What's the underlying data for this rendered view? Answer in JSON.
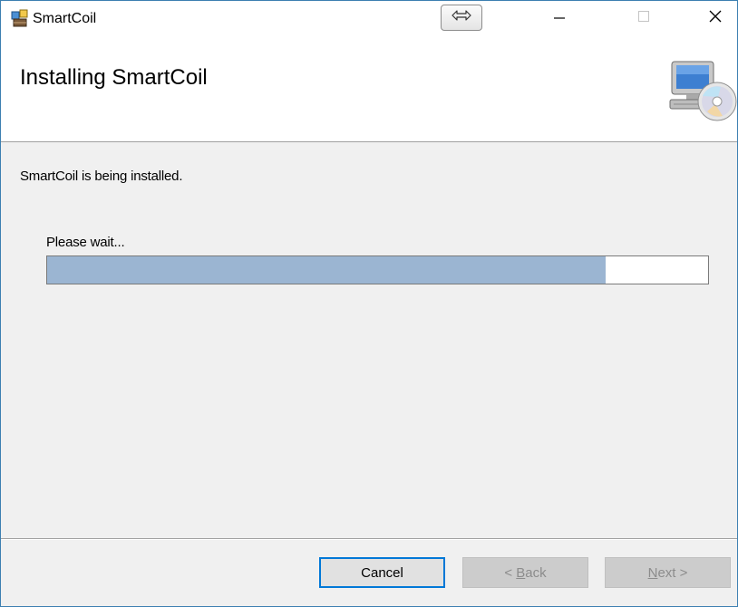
{
  "window": {
    "title": "SmartCoil"
  },
  "titlebar": {
    "icons": {
      "app": "installer-package-icon",
      "resize": "double-arrow-icon",
      "minimize": "minimize-icon",
      "maximize": "maximize-icon",
      "close": "close-icon"
    }
  },
  "header": {
    "title": "Installing SmartCoil",
    "icon": "computer-disc-icon"
  },
  "body": {
    "status": "SmartCoil is being installed.",
    "wait_label": "Please wait...",
    "progress_fraction": 0.845
  },
  "buttons": {
    "cancel": {
      "label": "Cancel"
    },
    "back": {
      "prefix": "< ",
      "mnemonic": "B",
      "rest": "ack"
    },
    "next": {
      "prefix": "",
      "mnemonic": "N",
      "rest": "ext >"
    }
  },
  "colors": {
    "progress_fill": "#9bb5d2",
    "focus_border": "#0078d7",
    "window_border": "#3c7fb1"
  }
}
